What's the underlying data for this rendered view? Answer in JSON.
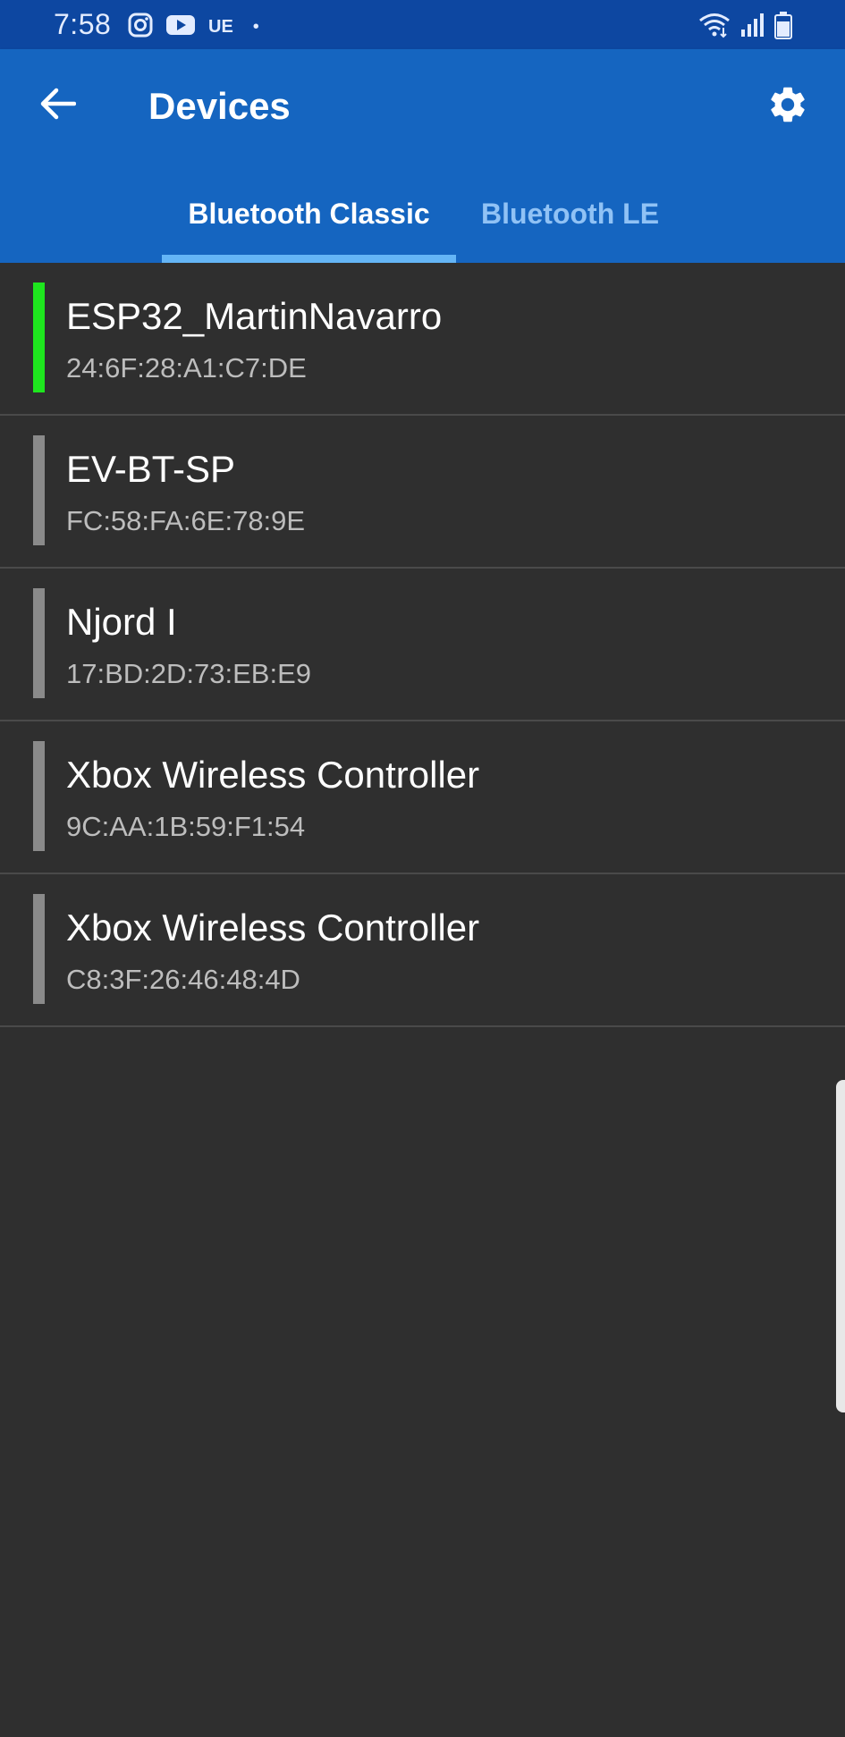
{
  "status_bar": {
    "time": "7:58",
    "carrier": "UE",
    "dot": "•",
    "icons_left": [
      "instagram-icon",
      "youtube-icon"
    ],
    "icons_right": [
      "wifi-icon",
      "signal-icon",
      "battery-icon"
    ]
  },
  "app_bar": {
    "title": "Devices",
    "back_icon": "arrow-back-icon",
    "settings_icon": "gear-icon"
  },
  "tabs": [
    {
      "label": "Bluetooth Classic",
      "selected": true
    },
    {
      "label": "Bluetooth LE",
      "selected": false
    }
  ],
  "devices": [
    {
      "name": "ESP32_MartinNavarro",
      "mac": "24:6F:28:A1:C7:DE",
      "status_color": "#1ee61e"
    },
    {
      "name": "EV-BT-SP",
      "mac": "FC:58:FA:6E:78:9E",
      "status_color": "#8a8a8a"
    },
    {
      "name": "Njord I",
      "mac": "17:BD:2D:73:EB:E9",
      "status_color": "#8a8a8a"
    },
    {
      "name": "Xbox Wireless Controller",
      "mac": "9C:AA:1B:59:F1:54",
      "status_color": "#8a8a8a"
    },
    {
      "name": "Xbox Wireless Controller",
      "mac": "C8:3F:26:46:48:4D",
      "status_color": "#8a8a8a"
    }
  ],
  "colors": {
    "app_bar": "#1565c0",
    "status_bar": "#0d47a1",
    "background": "#2f2f2f",
    "tab_indicator": "#64b5f6"
  }
}
